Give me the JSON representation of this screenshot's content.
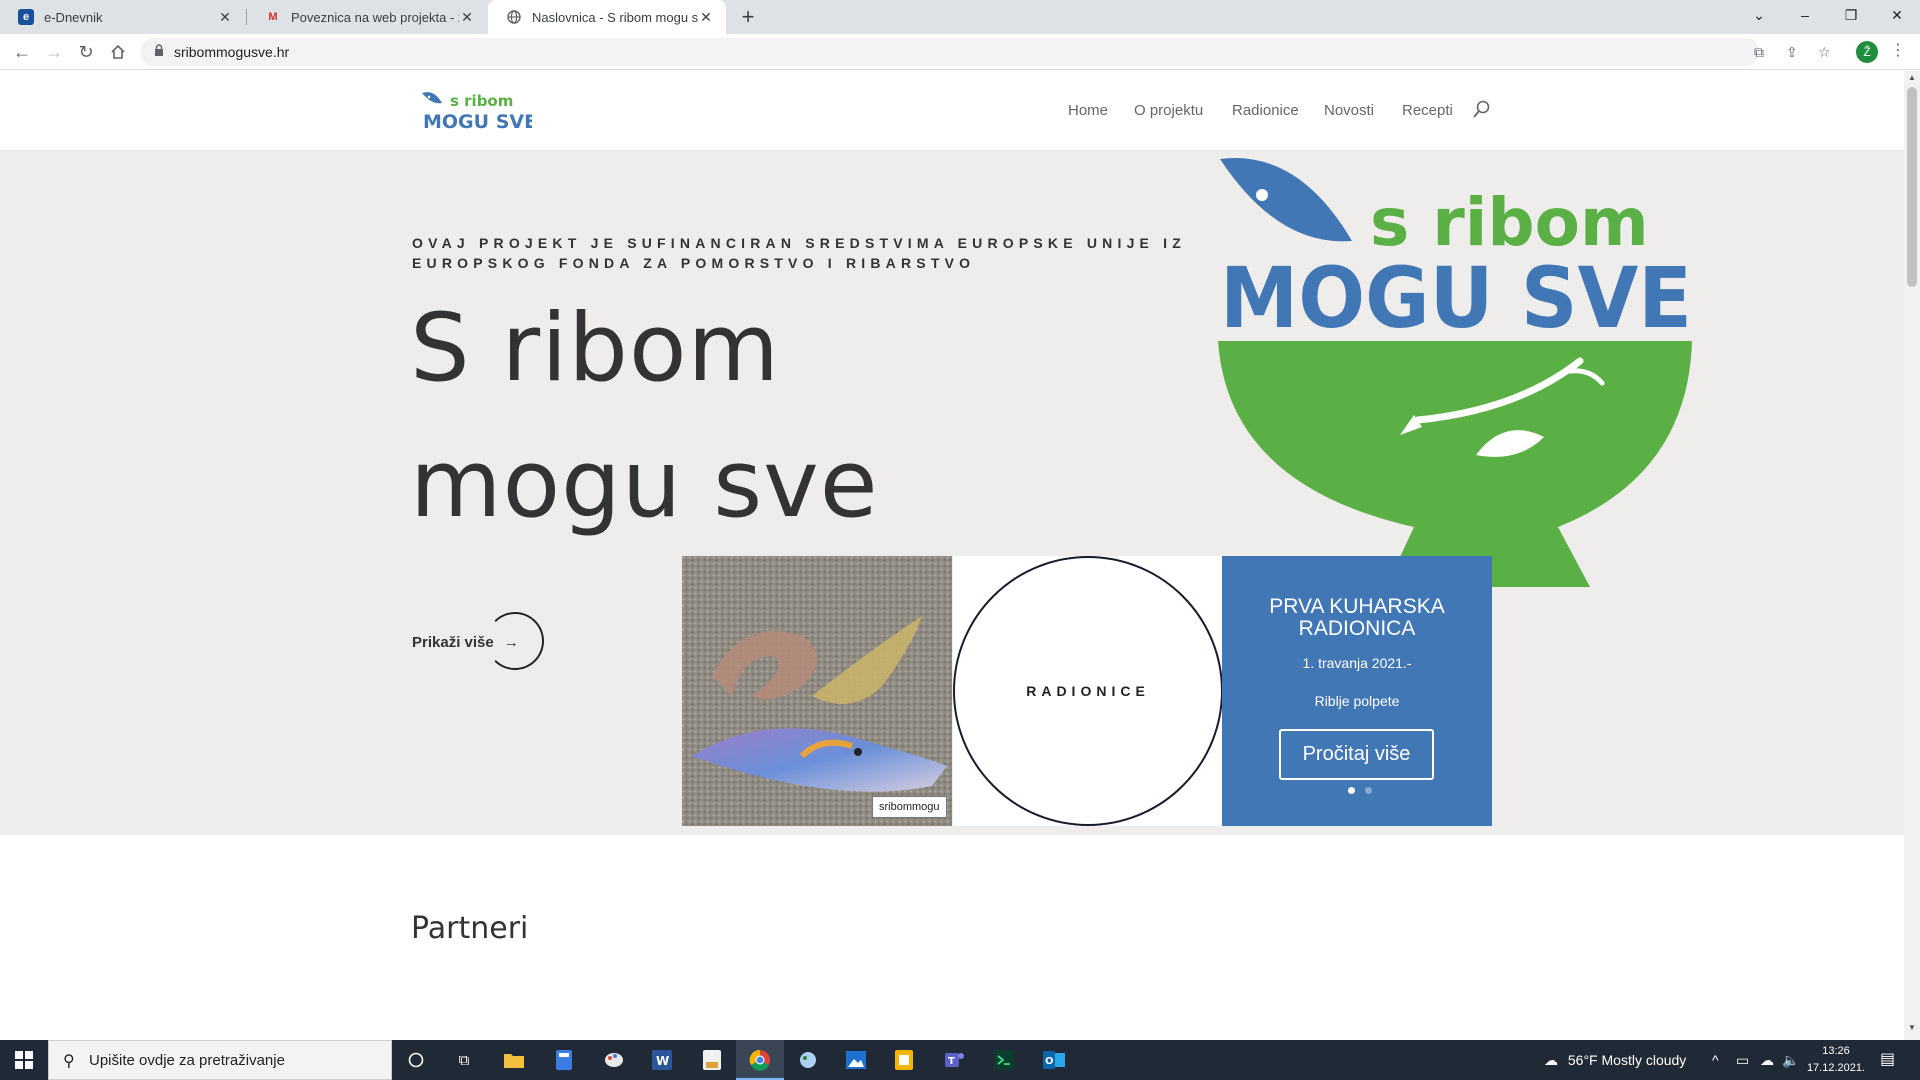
{
  "browser": {
    "tabs": [
      {
        "title": "e-Dnevnik",
        "favicon": "e"
      },
      {
        "title": "Poveznica na web projekta - zan",
        "favicon": "M"
      },
      {
        "title": "Naslovnica - S ribom mogu sve",
        "favicon": "globe"
      }
    ],
    "new_tab": "+",
    "url": "sribommogusve.hr",
    "profile_initial": "Ž",
    "window_controls": {
      "minimize": "–",
      "restore": "❐",
      "close": "✕",
      "tabsearch": "⌄"
    }
  },
  "site": {
    "logo": {
      "line1": "s ribom",
      "line2": "MOGU SVE"
    },
    "nav": [
      "Home",
      "O projektu",
      "Radionice",
      "Novosti",
      "Recepti"
    ],
    "hero": {
      "kicker": "OVAJ PROJEKT JE SUFINANCIRAN SREDSTVIMA EUROPSKE UNIJE IZ EUROPSKOG FONDA ZA POMORSTVO I RIBARSTVO",
      "title_line1": "S ribom",
      "title_line2": "mogu sve",
      "show_more": "Prikaži više",
      "arrow": "→"
    },
    "cards": {
      "image_tooltip": "sribommogu",
      "circle_label": "RADIONICE",
      "slide": {
        "heading": "PRVA KUHARSKA RADIONICA",
        "date": "1. travanja 2021.-",
        "subtitle": "Riblje polpete",
        "button": "Pročitaj više"
      }
    },
    "partners_heading": "Partneri",
    "brand_colors": {
      "blue": "#4277b5",
      "green": "#5ab044"
    }
  },
  "taskbar": {
    "search_placeholder": "Upišite ovdje za pretraživanje",
    "weather": "56°F  Mostly cloudy",
    "time": "13:26",
    "date": "17.12.2021."
  }
}
